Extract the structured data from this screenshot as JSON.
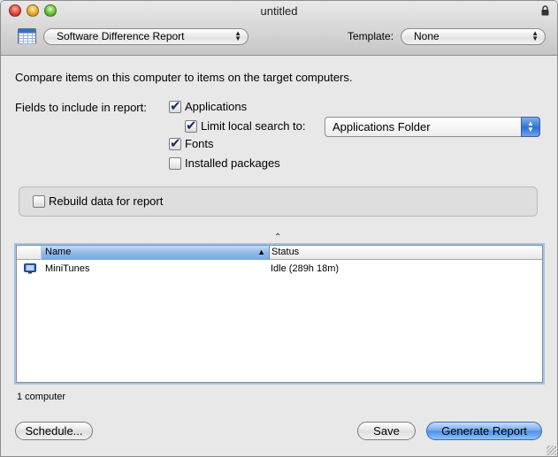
{
  "window": {
    "title": "untitled"
  },
  "toolbar": {
    "report_type": "Software Difference Report",
    "template_label": "Template:",
    "template_value": "None"
  },
  "main": {
    "description": "Compare items on this computer to items on the target computers.",
    "fields_label": "Fields to include in report:",
    "fields": [
      {
        "label": "Applications",
        "checked": true
      },
      {
        "label": "Limit local search to:",
        "checked": true
      },
      {
        "label": "Fonts",
        "checked": true
      },
      {
        "label": "Installed packages",
        "checked": false
      }
    ],
    "limit_search_value": "Applications Folder",
    "rebuild_label": "Rebuild data for report",
    "rebuild_checked": false
  },
  "list": {
    "columns": [
      "Name",
      "Status"
    ],
    "sort_column": "Name",
    "rows": [
      {
        "icon": "monitor-icon",
        "name": "MiniTunes",
        "status": "Idle (289h 18m)"
      }
    ],
    "count_text": "1 computer"
  },
  "buttons": {
    "schedule": "Schedule...",
    "save": "Save",
    "generate": "Generate Report"
  },
  "colors": {
    "accent": "#4a90ea",
    "selected_header": "#8fb9ec",
    "focus_ring": "#9ec1ef"
  }
}
